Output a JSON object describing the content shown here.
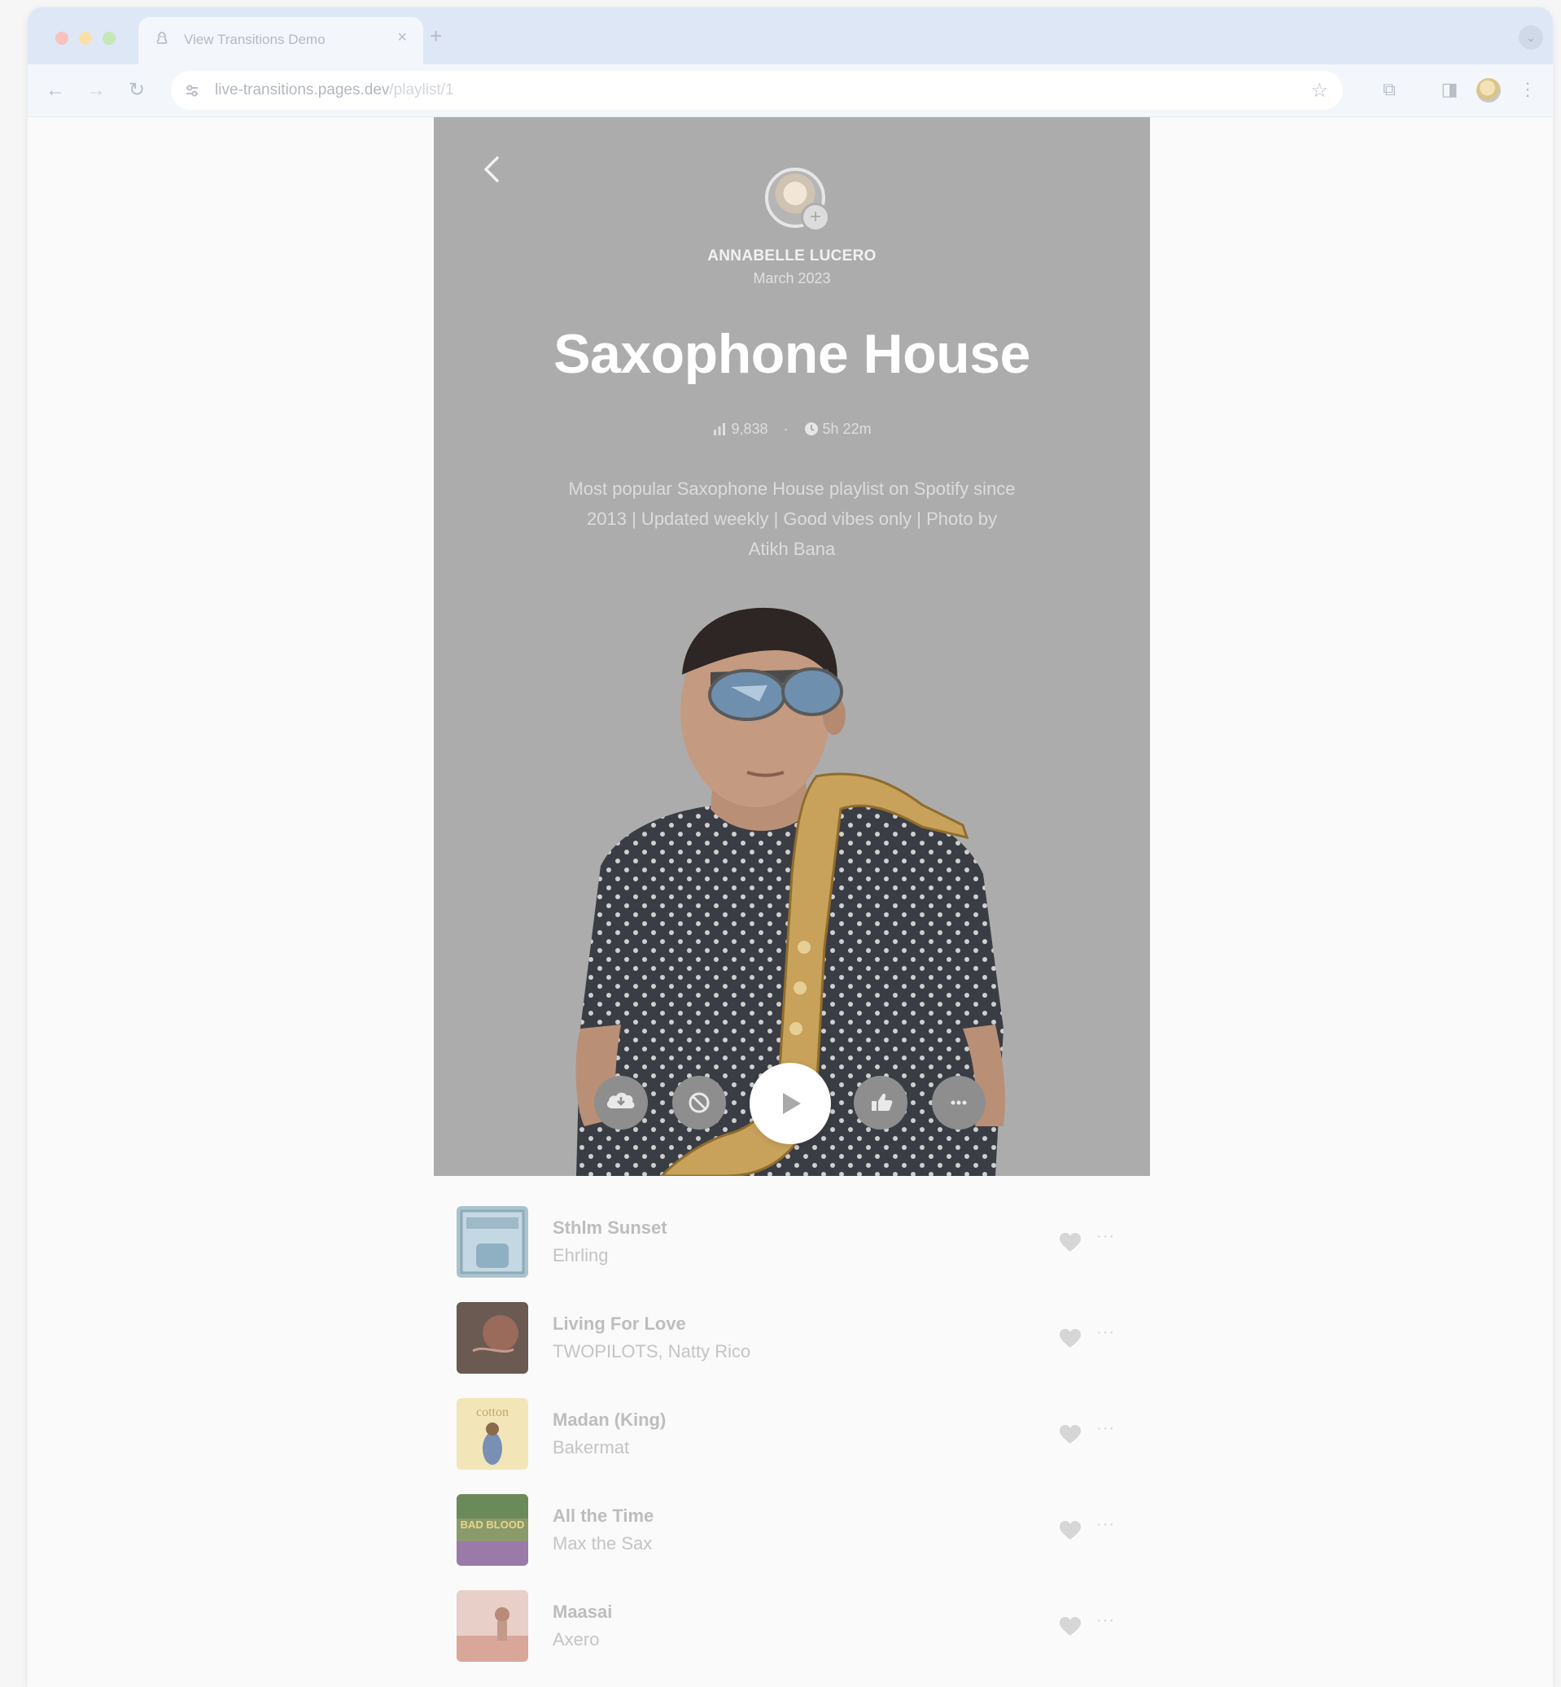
{
  "browser": {
    "tab_title": "View Transitions Demo",
    "tab_close": "×",
    "new_tab": "+",
    "tab_menu": "⌄",
    "url_host": "live-transitions.pages.dev",
    "url_path": "/playlist/1",
    "back": "←",
    "forward": "→",
    "reload": "↻",
    "bookmark": "☆",
    "extensions": "⧉",
    "sidepanel": "◨",
    "menu": "⋮"
  },
  "playlist": {
    "author_name": "ANNABELLE LUCERO",
    "author_date": "March 2023",
    "follow": "+",
    "title": "Saxophone House",
    "plays": "9,838",
    "separator": "·",
    "duration": "5h 22m",
    "description": "Most popular Saxophone House playlist on Spotify since 2013 | Updated weekly | Good vibes only | Photo by Atikh Bana"
  },
  "tracks": [
    {
      "title": "Sthlm Sunset",
      "artist": "Ehrling"
    },
    {
      "title": "Living For Love",
      "artist": "TWOPILOTS, Natty Rico"
    },
    {
      "title": "Madan (King)",
      "artist": "Bakermat"
    },
    {
      "title": "All the Time",
      "artist": "Max the Sax"
    },
    {
      "title": "Maasai",
      "artist": "Axero"
    }
  ],
  "track_more": "···",
  "cover_labels": {
    "madan": "cotton",
    "all_the_time": "BAD BLOOD"
  },
  "colors": {
    "hero_bg": "#acacac",
    "page_bg": "#fafafa",
    "tab_strip": "#dde7f5",
    "toolbar": "#f3f6fb"
  },
  "icons": {
    "download": "cloud-download-icon",
    "block": "block-icon",
    "play": "play-icon",
    "like": "thumbs-up-icon",
    "more": "more-icon",
    "heart": "heart-icon"
  }
}
